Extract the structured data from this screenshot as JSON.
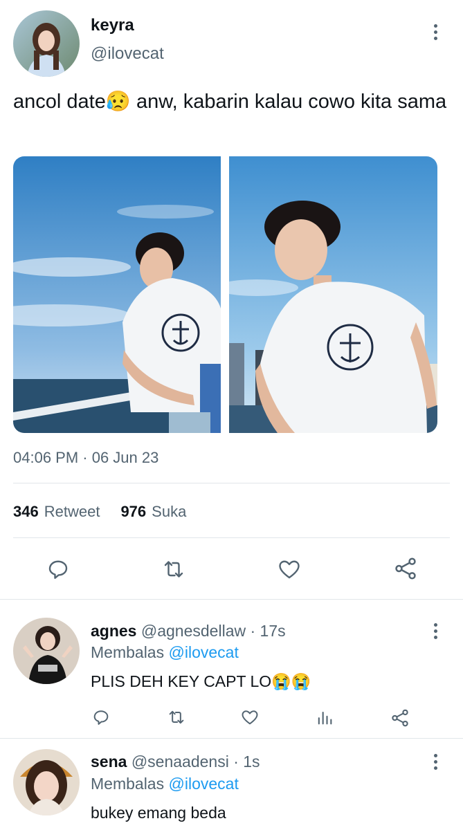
{
  "tweet": {
    "display_name": "keyra",
    "handle": "@ilovecat",
    "text": "ancol date😥 anw, kabarin kalau cowo kita sama",
    "timestamp": "04:06 PM · 06 Jun 23",
    "stats": {
      "retweets_count": "346",
      "retweets_label": "Retweet",
      "likes_count": "976",
      "likes_label": "Suka"
    },
    "actions": [
      "reply-icon",
      "retweet-icon",
      "like-icon",
      "share-icon"
    ]
  },
  "replies": [
    {
      "display_name": "agnes",
      "handle": "@agnesdellaw",
      "time": "· 17s",
      "replying_prefix": "Membalas",
      "replying_to": "@ilovecat",
      "text": "PLIS DEH KEY CAPT LO😭😭"
    },
    {
      "display_name": "sena",
      "handle": "@senaadensi",
      "time": "· 1s",
      "replying_prefix": "Membalas",
      "replying_to": "@ilovecat",
      "text": "bukey emang beda"
    }
  ],
  "colors": {
    "accent": "#1d9bf0",
    "secondary_text": "#536471",
    "divider": "#e1e6ea"
  }
}
